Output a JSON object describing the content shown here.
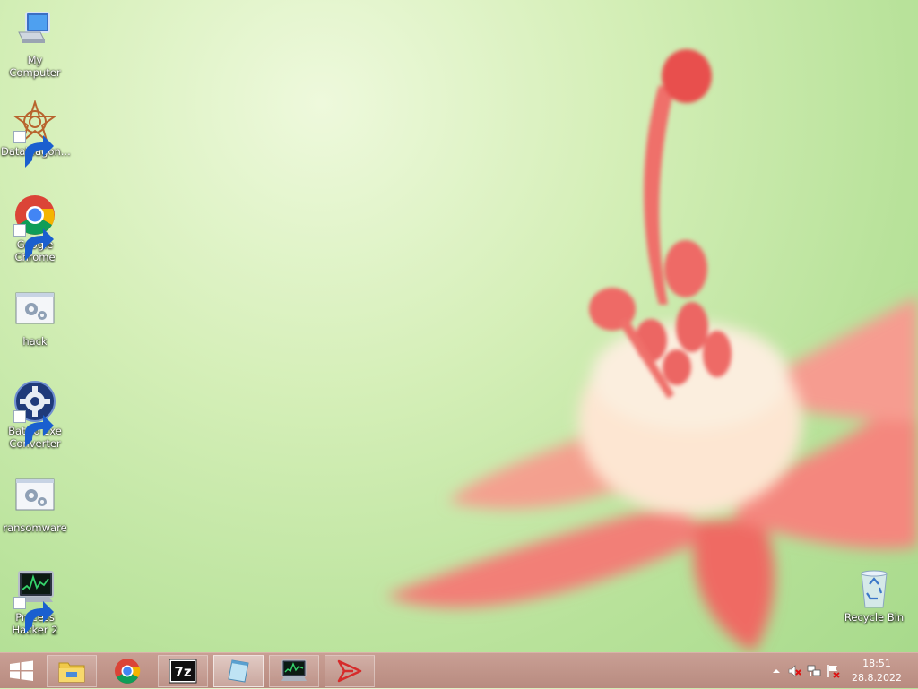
{
  "desktop": {
    "icons": [
      {
        "label": "My Computer",
        "icon": "computer-icon"
      },
      {
        "label": "DataWagon...",
        "icon": "datawagon-icon"
      },
      {
        "label": "Google Chrome",
        "icon": "chrome-icon"
      },
      {
        "label": "hack",
        "icon": "batch-file-icon"
      },
      {
        "label": "Bat To Exe Converter",
        "icon": "gear-app-icon"
      },
      {
        "label": "ransomware",
        "icon": "batch-file-icon"
      },
      {
        "label": "Process Hacker 2",
        "icon": "process-hacker-icon"
      },
      {
        "label": "Recycle Bin",
        "icon": "recycle-bin-icon"
      }
    ]
  },
  "taskbar": {
    "start": {
      "icon": "windows-logo-icon"
    },
    "pinned": [
      {
        "name": "File Explorer",
        "icon": "folder-icon"
      },
      {
        "name": "Google Chrome",
        "icon": "chrome-icon"
      },
      {
        "name": "7-Zip",
        "icon": "7zip-icon"
      },
      {
        "name": "Notepad",
        "icon": "notepad-icon"
      },
      {
        "name": "Process Hacker",
        "icon": "process-hacker-icon"
      },
      {
        "name": "App",
        "icon": "red-arrow-icon"
      }
    ],
    "tray": {
      "icons": [
        "show-hidden-icons-arrow",
        "volume-muted-icon",
        "network-icon",
        "action-center-flag-icon"
      ],
      "time": "18:51",
      "date": "28.8.2022"
    }
  },
  "colors": {
    "taskbar": "#c09488",
    "wallpaper_green": "#b8e29a",
    "flower_red": "#ef6f6a"
  }
}
